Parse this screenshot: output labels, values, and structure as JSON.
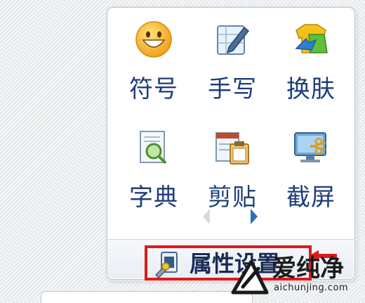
{
  "tools": [
    {
      "label": "符号",
      "icon": "smiley-icon"
    },
    {
      "label": "手写",
      "icon": "handwriting-icon"
    },
    {
      "label": "换肤",
      "icon": "skin-shirt-icon"
    },
    {
      "label": "字典",
      "icon": "dictionary-icon"
    },
    {
      "label": "剪贴",
      "icon": "clipboard-icon"
    },
    {
      "label": "截屏",
      "icon": "screenshot-icon"
    }
  ],
  "footer": {
    "properties_label": "属性设置",
    "properties_icon": "settings-wrench-icon"
  },
  "watermark": {
    "name": "爱纯净",
    "url": "aichunjing.com",
    "logo": "aichunjing-logo"
  },
  "colors": {
    "label": "#1e3d7a",
    "highlight": "#e0191c",
    "border": "#b9c4cf"
  }
}
